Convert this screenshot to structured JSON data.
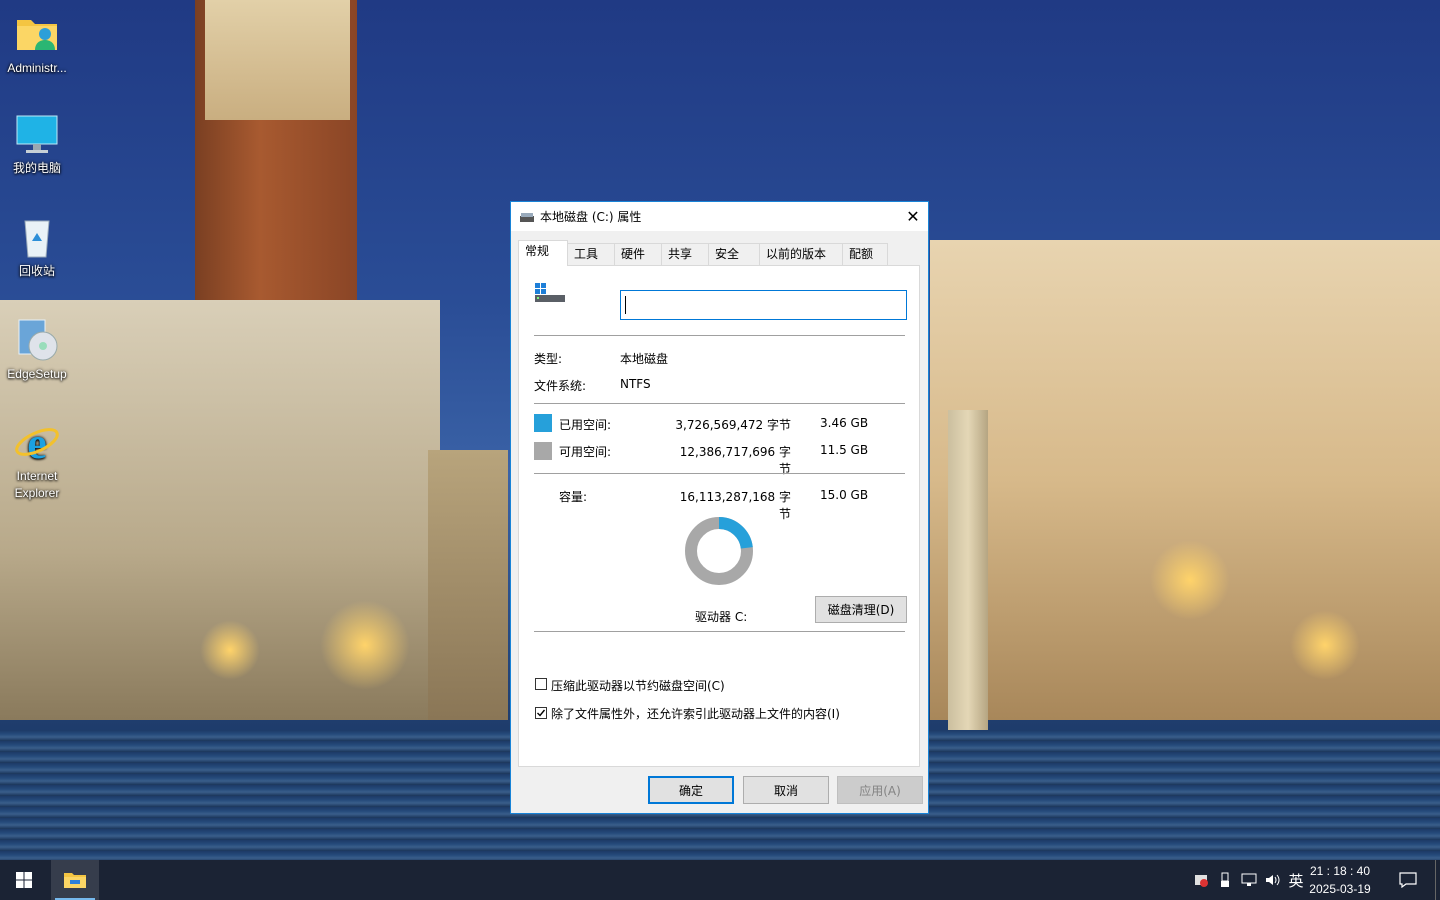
{
  "desktop": {
    "icons": [
      {
        "label": "Administr...",
        "icon": "user-folder-icon"
      },
      {
        "label": "我的电脑",
        "icon": "computer-icon"
      },
      {
        "label": "回收站",
        "icon": "recycle-bin-icon"
      },
      {
        "label": "EdgeSetup",
        "icon": "installer-icon"
      },
      {
        "label": "Internet\nExplorer",
        "icon": "internet-explorer-icon"
      }
    ]
  },
  "dialog": {
    "title": "本地磁盘 (C:) 属性",
    "tabs": [
      "常规",
      "工具",
      "硬件",
      "共享",
      "安全",
      "以前的版本",
      "配额"
    ],
    "active_tab": "常规",
    "volume_name_value": "",
    "type_label": "类型:",
    "type_value": "本地磁盘",
    "fs_label": "文件系统:",
    "fs_value": "NTFS",
    "used": {
      "label": "已用空间:",
      "bytes": "3,726,569,472 字节",
      "size": "3.46 GB",
      "color": "#26a0da"
    },
    "free": {
      "label": "可用空间:",
      "bytes": "12,386,717,696 字节",
      "size": "11.5 GB",
      "color": "#a8a8a8"
    },
    "capacity": {
      "label": "容量:",
      "bytes": "16,113,287,168 字节",
      "size": "15.0 GB"
    },
    "used_fraction": 0.2313,
    "drive_label": "驱动器 C:",
    "cleanup_button": "磁盘清理(D)",
    "compress_checkbox": {
      "label": "压缩此驱动器以节约磁盘空间(C)",
      "checked": false
    },
    "index_checkbox": {
      "label": "除了文件属性外，还允许索引此驱动器上文件的内容(I)",
      "checked": true
    },
    "ok_button": "确定",
    "cancel_button": "取消",
    "apply_button": "应用(A)"
  },
  "taskbar": {
    "tray": {
      "ime": "英",
      "time": "21 : 18 : 40",
      "date": "2025-03-19"
    }
  }
}
